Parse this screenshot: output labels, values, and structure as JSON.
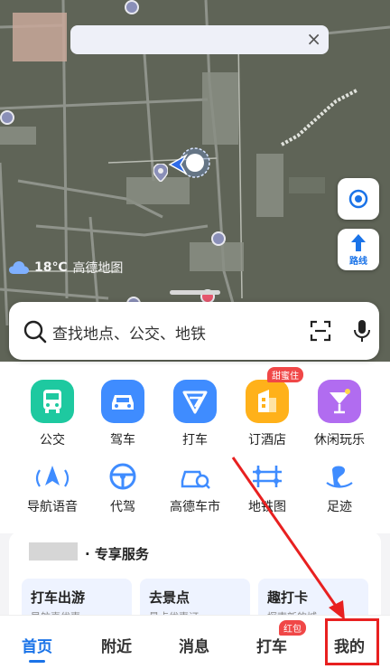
{
  "notification": {
    "close_glyph": "×"
  },
  "weather": {
    "temperature": "18℃",
    "map_brand": "高德地图",
    "icon": "cloud-icon"
  },
  "map_controls": {
    "route_label": "路线"
  },
  "search": {
    "placeholder": "查找地点、公交、地铁"
  },
  "services_row1": [
    {
      "label": "公交",
      "icon": "bus-icon",
      "color": "#1ec9a0"
    },
    {
      "label": "驾车",
      "icon": "car-icon",
      "color": "#3f8cff"
    },
    {
      "label": "打车",
      "icon": "taxi-icon",
      "color": "#3f8cff"
    },
    {
      "label": "订酒店",
      "icon": "hotel-icon",
      "color": "#ffb11a",
      "badge": "甜蜜住"
    },
    {
      "label": "休闲玩乐",
      "icon": "cocktail-icon",
      "color": "#b16cf0"
    }
  ],
  "services_row2": [
    {
      "label": "导航语音",
      "icon": "navigation-voice-icon"
    },
    {
      "label": "代驾",
      "icon": "steering-wheel-icon"
    },
    {
      "label": "高德车市",
      "icon": "car-search-icon"
    },
    {
      "label": "地铁图",
      "icon": "metro-map-icon"
    },
    {
      "label": "足迹",
      "icon": "footprint-icon"
    }
  ],
  "exclusive": {
    "title": "· 专享服务",
    "cards": [
      {
        "name": "打车出游",
        "sub": "导航喜优惠"
      },
      {
        "name": "去景点",
        "sub": "景点优惠订"
      },
      {
        "name": "趣打卡",
        "sub": "探索新的城"
      }
    ]
  },
  "tabs": [
    {
      "label": "首页",
      "active": true
    },
    {
      "label": "附近"
    },
    {
      "label": "消息"
    },
    {
      "label": "打车",
      "badge": "红包"
    },
    {
      "label": "我的"
    }
  ],
  "colors": {
    "accent": "#1a73e8",
    "highlight": "#e82020"
  }
}
